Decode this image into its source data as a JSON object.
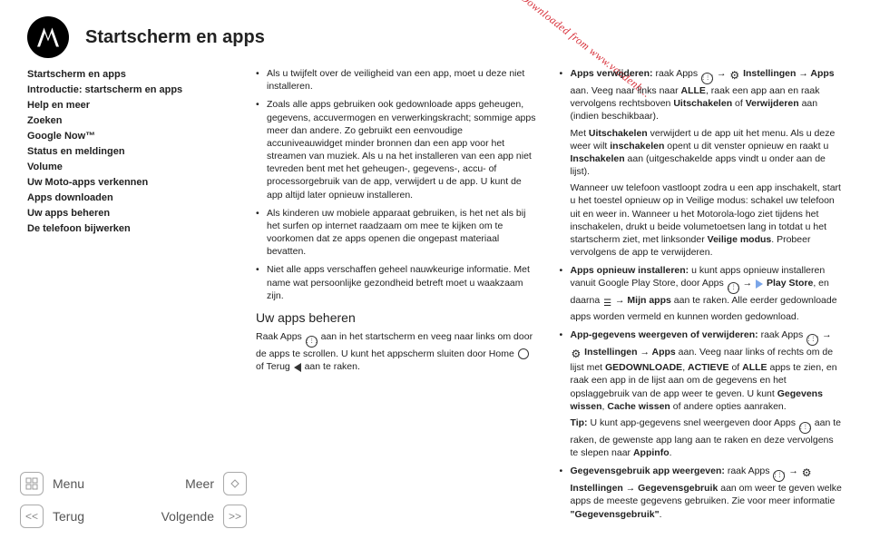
{
  "watermark": "Downloaded from www.vandenb...",
  "header": {
    "title": "Startscherm en apps"
  },
  "sidebar": {
    "items": [
      "Startscherm en apps",
      "Introductie: startscherm en apps",
      "Help en meer",
      "Zoeken",
      "Google Now™",
      "Status en meldingen",
      "Volume",
      "Uw Moto-apps verkennen",
      "Apps downloaden",
      "Uw apps beheren",
      "De telefoon bijwerken"
    ]
  },
  "nav": {
    "menu": "Menu",
    "more": "Meer",
    "back": "Terug",
    "next": "Volgende"
  },
  "content": {
    "col1": {
      "b1": "Als u twijfelt over de veiligheid van een app, moet u deze niet installeren.",
      "b2": "Zoals alle apps gebruiken ook gedownloade apps geheugen, gegevens, accuvermogen en verwerkingskracht; sommige apps meer dan andere. Zo gebruikt een eenvoudige accuniveauwidget minder bronnen dan een app voor het streamen van muziek. Als u na het installeren van een app niet tevreden bent met het geheugen-, gegevens-, accu- of processorgebruik van de app, verwijdert u de app. U kunt de app altijd later opnieuw installeren.",
      "b3": "Als kinderen uw mobiele apparaat gebruiken, is het net als bij het surfen op internet raadzaam om mee te kijken om te voorkomen dat ze apps openen die ongepast materiaal bevatten.",
      "b4": "Niet alle apps verschaffen geheel nauwkeurige informatie. Met name wat persoonlijke gezondheid betreft moet u waakzaam zijn.",
      "h": "Uw apps beheren",
      "lead_a": "Raak Apps ",
      "lead_b": " aan in het startscherm en veeg naar links om door de apps te scrollen. U kunt het appscherm sluiten door Home ",
      "lead_c": " of Terug ",
      "lead_d": " aan te raken.",
      "rm1_a": "Apps verwijderen:",
      "rm1_b": " raak Apps ",
      "rm1_c": " Instellingen ",
      "rm1_d": " Apps",
      "rm1_e": " aan. Veeg naar links naar ",
      "rm1_f": "ALLE",
      "rm1_g": ", raak een app aan en raak vervolgens rechtsboven ",
      "rm1_h": "Uitschakelen",
      "rm1_i": " of ",
      "rm1_j": "Verwijderen",
      "rm1_k": " aan (indien beschikbaar).",
      "rm2_a": "Met ",
      "rm2_b": "Uitschakelen",
      "rm2_c": " verwijdert u de app uit het menu. Als u deze weer wilt ",
      "rm2_d": "inschakelen",
      "rm2_e": " opent u dit venster opnieuw en "
    },
    "col2": {
      "c0_a": "raakt u ",
      "c0_b": "Inschakelen",
      "c0_c": " aan (uitgeschakelde apps vindt u onder aan de lijst).",
      "c1_a": "Wanneer uw telefoon vastloopt zodra u een app inschakelt, start u het toestel opnieuw op in Veilige modus: schakel uw telefoon uit en weer in. Wanneer u het Motorola-logo ziet tijdens het inschakelen, drukt u beide volumetoetsen lang in totdat u het startscherm ziet, met linksonder ",
      "c1_b": "Veilige modus",
      "c1_c": ". Probeer vervolgens de app te verwijderen.",
      "r1_a": "Apps opnieuw installeren:",
      "r1_b": " u kunt apps opnieuw installeren vanuit Google Play Store, door Apps ",
      "r1_c": " Play Store",
      "r1_d": ", en daarna ",
      "r1_e": " Mijn apps",
      "r1_f": " aan te raken. Alle eerder gedownloade apps worden vermeld en kunnen worden gedownload.",
      "r2_a": "App-gegevens weergeven of verwijderen:",
      "r2_b": " raak Apps ",
      "r2_c": " Instellingen ",
      "r2_d": " Apps",
      "r2_e": " aan. Veeg naar links of rechts om de lijst met ",
      "r2_f": "GEDOWNLOADE",
      "r2_g": "ACTIEVE",
      "r2_h": " of ",
      "r2_i": "ALLE",
      "r2_j": " apps te zien, en raak een app in de lijst aan om de gegevens en het opslaggebruik van de app weer te geven. U kunt ",
      "r2_k": "Gegevens wissen",
      "r2_l": "Cache wissen",
      "r2_m": " of andere opties aanraken.",
      "tip_a": "Tip:",
      "tip_b": " U kunt app-gegevens snel weergeven door Apps ",
      "tip_c": " aan te raken, de gewenste app lang aan te raken en deze vervolgens te slepen naar ",
      "tip_d": "Appinfo",
      "r3_a": "Gegevensgebruik app weergeven:",
      "r3_b": " raak Apps ",
      "r3_c": " Instellingen ",
      "r3_d": " Gegevensgebruik",
      "r3_e": " aan om weer te geven welke apps de meeste gegevens gebruiken. Zie voor meer informatie ",
      "r3_f": "\"Gegevensgebruik\""
    }
  }
}
